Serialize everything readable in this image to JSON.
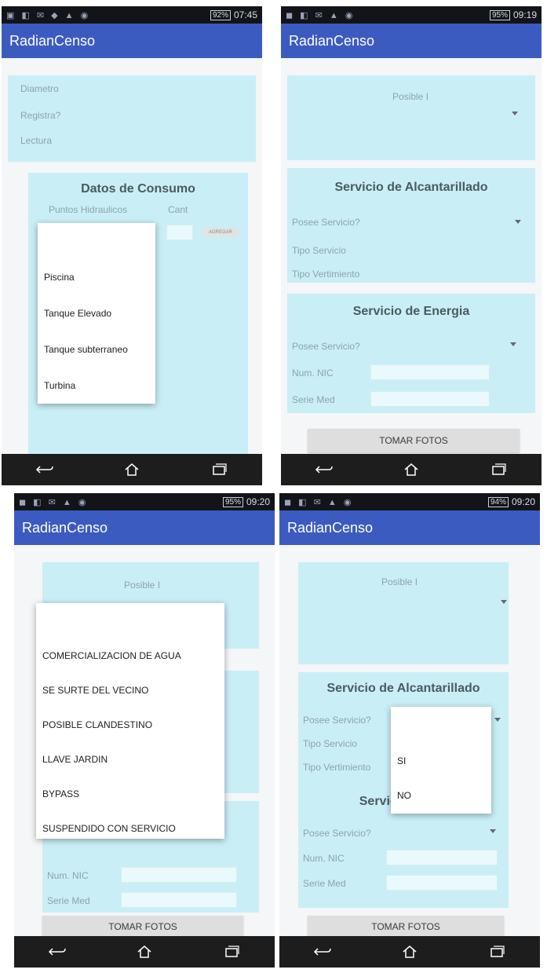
{
  "app_title": "RadianCenso",
  "status_times": [
    "07:45",
    "09:19",
    "09:20",
    "09:20"
  ],
  "battery_levels": [
    "92%",
    "95%",
    "95%",
    "94%"
  ],
  "colors": {
    "appbar": "#3c5bc0",
    "panel": "#c9eef6",
    "statusbar": "#12141a",
    "navbar": "#1d1d1d"
  },
  "icons": {
    "back": "back-icon",
    "home": "home-icon",
    "recent": "recent-apps-icon"
  },
  "screen1": {
    "fields": [
      "Diametro",
      "Registra?",
      "Lectura"
    ],
    "consumo_title": "Datos de Consumo",
    "col_points": "Puntos Hidraulicos",
    "col_qty": "Cant",
    "add_button": "AGREGAR",
    "options": [
      "Piscina",
      "Tanque Elevado",
      "Tanque subterraneo",
      "Turbina"
    ]
  },
  "screen2": {
    "posible_label": "Posible I",
    "alcantarillado_title": "Servicio de Alcantarillado",
    "posee_servicio": "Posee Servicio?",
    "tipo_servicio": "Tipo Servicio",
    "tipo_vertimiento": "Tipo Vertimiento",
    "energia_title": "Servicio de Energia",
    "energia_posee": "Posee Servicio?",
    "num_nic": "Num. NIC",
    "serie_med": "Serie Med",
    "photos_button": "TOMAR FOTOS"
  },
  "screen3": {
    "posible_label": "Posible I",
    "num_nic": "Num. NIC",
    "serie_med": "Serie Med",
    "photos_button": "TOMAR FOTOS",
    "options": [
      "COMERCIALIZACION DE AGUA",
      "SE SURTE DEL VECINO",
      "POSIBLE CLANDESTINO",
      "LLAVE JARDIN",
      "BYPASS",
      "SUSPENDIDO CON SERVICIO"
    ]
  },
  "screen4": {
    "posible_label": "Posible I",
    "alcantarillado_title": "Servicio de Alcantarillado",
    "posee_servicio": "Posee Servicio?",
    "tipo_servicio": "Tipo Servicio",
    "tipo_vertimiento": "Tipo Vertimiento",
    "energia_title_partial": "Servici",
    "energia_posee": "Posee Servicio?",
    "num_nic": "Num. NIC",
    "serie_med": "Serie Med",
    "photos_button": "TOMAR FOTOS",
    "options": [
      "SI",
      "NO"
    ]
  }
}
